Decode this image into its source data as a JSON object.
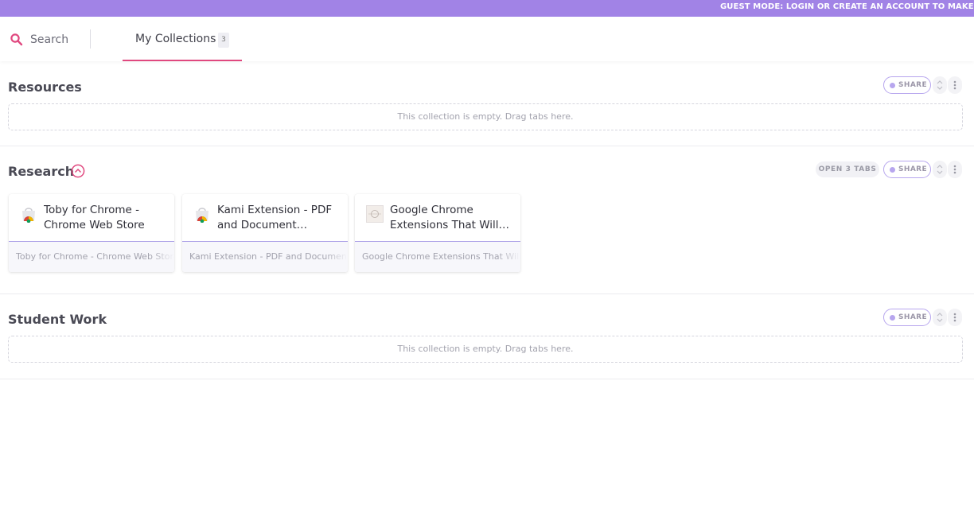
{
  "banner": {
    "text": "GUEST MODE: LOGIN OR CREATE AN ACCOUNT TO MAKE SURE YOUR DATA IS SAVED"
  },
  "topbar": {
    "search_label": "Search",
    "tab": {
      "label": "My Collections",
      "count": "3"
    }
  },
  "colors": {
    "accent": "#e0487f",
    "brand": "#a183e6",
    "share_border": "#b7a6ee"
  },
  "collections": [
    {
      "title": "Resources",
      "share_label": "SHARE",
      "empty_text": "This collection is empty. Drag tabs here."
    },
    {
      "title": "Research",
      "share_label": "SHARE",
      "open_tabs_label": "OPEN 3 TABS",
      "cards": [
        {
          "title": "Toby for Chrome - Chrome Web Store",
          "footer": "Toby for Chrome - Chrome Web Store",
          "icon": "chrome-web-store-icon"
        },
        {
          "title": "Kami Extension - PDF and Document…",
          "footer": "Kami Extension - PDF and Document Annotation",
          "icon": "chrome-web-store-icon"
        },
        {
          "title": "Google Chrome Extensions That Will…",
          "footer": "Google Chrome Extensions That Will",
          "icon": "site-favicon"
        }
      ]
    },
    {
      "title": "Student Work",
      "share_label": "SHARE",
      "empty_text": "This collection is empty. Drag tabs here."
    }
  ]
}
